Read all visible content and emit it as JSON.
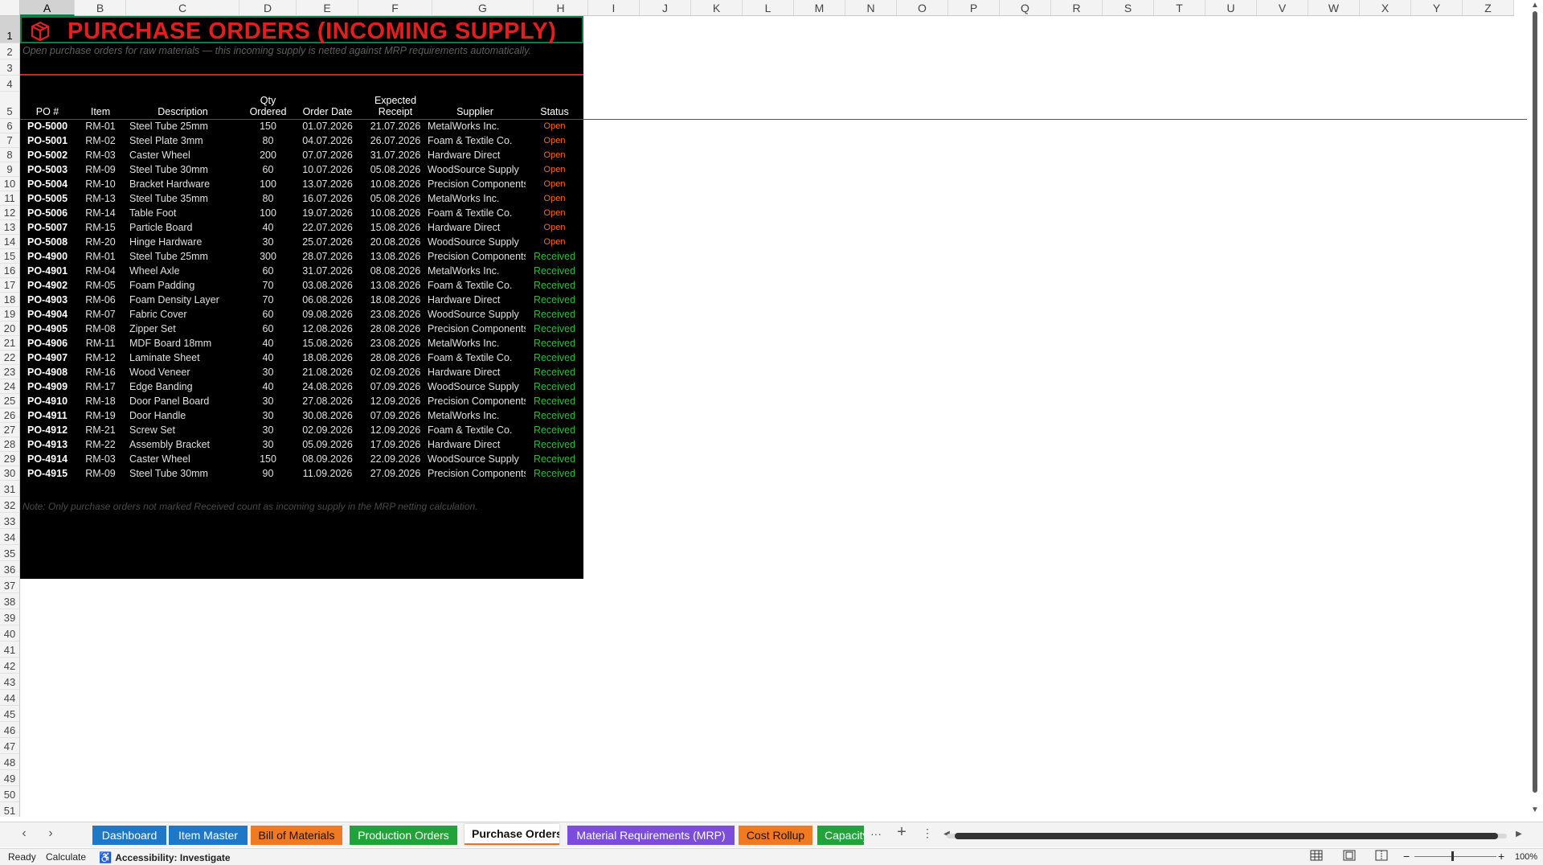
{
  "columns": [
    "A",
    "B",
    "C",
    "D",
    "E",
    "F",
    "G",
    "H",
    "I",
    "J",
    "K",
    "L",
    "M",
    "N",
    "O",
    "P",
    "Q",
    "R",
    "S",
    "T",
    "U",
    "V",
    "W",
    "X",
    "Y",
    "Z"
  ],
  "row_numbers": [
    1,
    2,
    3,
    4,
    5,
    6,
    7,
    8,
    9,
    10,
    11,
    12,
    13,
    14,
    15,
    16,
    17,
    18,
    19,
    20,
    21,
    22,
    23,
    24,
    25,
    26,
    27,
    28,
    29,
    30,
    31,
    32,
    33,
    34,
    35,
    36,
    37,
    38,
    39,
    40,
    41,
    42,
    43,
    44,
    45,
    46,
    47,
    48,
    49,
    50,
    51
  ],
  "sheet": {
    "title": "PURCHASE ORDERS (INCOMING SUPPLY)",
    "subtitle": "Open purchase orders for raw materials — this incoming supply is netted against MRP requirements automatically.",
    "headers": [
      "PO #",
      "Item",
      "Description",
      "Qty\nOrdered",
      "Order Date",
      "Expected\nReceipt",
      "Supplier",
      "Status"
    ],
    "rows": [
      [
        "PO-5000",
        "RM-01",
        "Steel Tube 25mm",
        "150",
        "01.07.2026",
        "21.07.2026",
        "MetalWorks Inc.",
        "Open"
      ],
      [
        "PO-5001",
        "RM-02",
        "Steel Plate 3mm",
        "80",
        "04.07.2026",
        "26.07.2026",
        "Foam & Textile Co.",
        "Open"
      ],
      [
        "PO-5002",
        "RM-03",
        "Caster Wheel",
        "200",
        "07.07.2026",
        "31.07.2026",
        "Hardware Direct",
        "Open"
      ],
      [
        "PO-5003",
        "RM-09",
        "Steel Tube 30mm",
        "60",
        "10.07.2026",
        "05.08.2026",
        "WoodSource Supply",
        "Open"
      ],
      [
        "PO-5004",
        "RM-10",
        "Bracket Hardware",
        "100",
        "13.07.2026",
        "10.08.2026",
        "Precision Components",
        "Open"
      ],
      [
        "PO-5005",
        "RM-13",
        "Steel Tube 35mm",
        "80",
        "16.07.2026",
        "05.08.2026",
        "MetalWorks Inc.",
        "Open"
      ],
      [
        "PO-5006",
        "RM-14",
        "Table Foot",
        "100",
        "19.07.2026",
        "10.08.2026",
        "Foam & Textile Co.",
        "Open"
      ],
      [
        "PO-5007",
        "RM-15",
        "Particle Board",
        "40",
        "22.07.2026",
        "15.08.2026",
        "Hardware Direct",
        "Open"
      ],
      [
        "PO-5008",
        "RM-20",
        "Hinge Hardware",
        "30",
        "25.07.2026",
        "20.08.2026",
        "WoodSource Supply",
        "Open"
      ],
      [
        "PO-4900",
        "RM-01",
        "Steel Tube 25mm",
        "300",
        "28.07.2026",
        "13.08.2026",
        "Precision Components",
        "Received"
      ],
      [
        "PO-4901",
        "RM-04",
        "Wheel Axle",
        "60",
        "31.07.2026",
        "08.08.2026",
        "MetalWorks Inc.",
        "Received"
      ],
      [
        "PO-4902",
        "RM-05",
        "Foam Padding",
        "70",
        "03.08.2026",
        "13.08.2026",
        "Foam & Textile Co.",
        "Received"
      ],
      [
        "PO-4903",
        "RM-06",
        "Foam Density Layer",
        "70",
        "06.08.2026",
        "18.08.2026",
        "Hardware Direct",
        "Received"
      ],
      [
        "PO-4904",
        "RM-07",
        "Fabric Cover",
        "60",
        "09.08.2026",
        "23.08.2026",
        "WoodSource Supply",
        "Received"
      ],
      [
        "PO-4905",
        "RM-08",
        "Zipper Set",
        "60",
        "12.08.2026",
        "28.08.2026",
        "Precision Components",
        "Received"
      ],
      [
        "PO-4906",
        "RM-11",
        "MDF Board 18mm",
        "40",
        "15.08.2026",
        "23.08.2026",
        "MetalWorks Inc.",
        "Received"
      ],
      [
        "PO-4907",
        "RM-12",
        "Laminate Sheet",
        "40",
        "18.08.2026",
        "28.08.2026",
        "Foam & Textile Co.",
        "Received"
      ],
      [
        "PO-4908",
        "RM-16",
        "Wood Veneer",
        "30",
        "21.08.2026",
        "02.09.2026",
        "Hardware Direct",
        "Received"
      ],
      [
        "PO-4909",
        "RM-17",
        "Edge Banding",
        "40",
        "24.08.2026",
        "07.09.2026",
        "WoodSource Supply",
        "Received"
      ],
      [
        "PO-4910",
        "RM-18",
        "Door Panel Board",
        "30",
        "27.08.2026",
        "12.09.2026",
        "Precision Components",
        "Received"
      ],
      [
        "PO-4911",
        "RM-19",
        "Door Handle",
        "30",
        "30.08.2026",
        "07.09.2026",
        "MetalWorks Inc.",
        "Received"
      ],
      [
        "PO-4912",
        "RM-21",
        "Screw Set",
        "30",
        "02.09.2026",
        "12.09.2026",
        "Foam & Textile Co.",
        "Received"
      ],
      [
        "PO-4913",
        "RM-22",
        "Assembly Bracket",
        "30",
        "05.09.2026",
        "17.09.2026",
        "Hardware Direct",
        "Received"
      ],
      [
        "PO-4914",
        "RM-03",
        "Caster Wheel",
        "150",
        "08.09.2026",
        "22.09.2026",
        "WoodSource Supply",
        "Received"
      ],
      [
        "PO-4915",
        "RM-09",
        "Steel Tube 30mm",
        "90",
        "11.09.2026",
        "27.09.2026",
        "Precision Components",
        "Received"
      ]
    ],
    "note": "Note: Only purchase orders not marked Received count as incoming supply in the MRP netting calculation."
  },
  "tabs": [
    {
      "label": "Dashboard",
      "color": "#1f77c8"
    },
    {
      "label": "Item Master",
      "color": "#1f77c8"
    },
    {
      "label": "Bill of Materials",
      "color": "#f07a22"
    },
    {
      "label": "Production Orders",
      "color": "#22a33a"
    },
    {
      "label": "Purchase Orders",
      "color": "#ffffff",
      "active": true
    },
    {
      "label": "Material Requirements (MRP)",
      "color": "#7c4ddb"
    },
    {
      "label": "Cost Rollup",
      "color": "#f07a22"
    },
    {
      "label": "Capacity",
      "color": "#22a33a"
    }
  ],
  "status": {
    "ready": "Ready",
    "calculate": "Calculate",
    "accessibility": "Accessibility: Investigate",
    "zoom": "100%"
  },
  "colors": {
    "title_red": "#e02020",
    "open": "#ff6a00",
    "received": "#2dbd3c",
    "accent_line": "#c62828"
  }
}
